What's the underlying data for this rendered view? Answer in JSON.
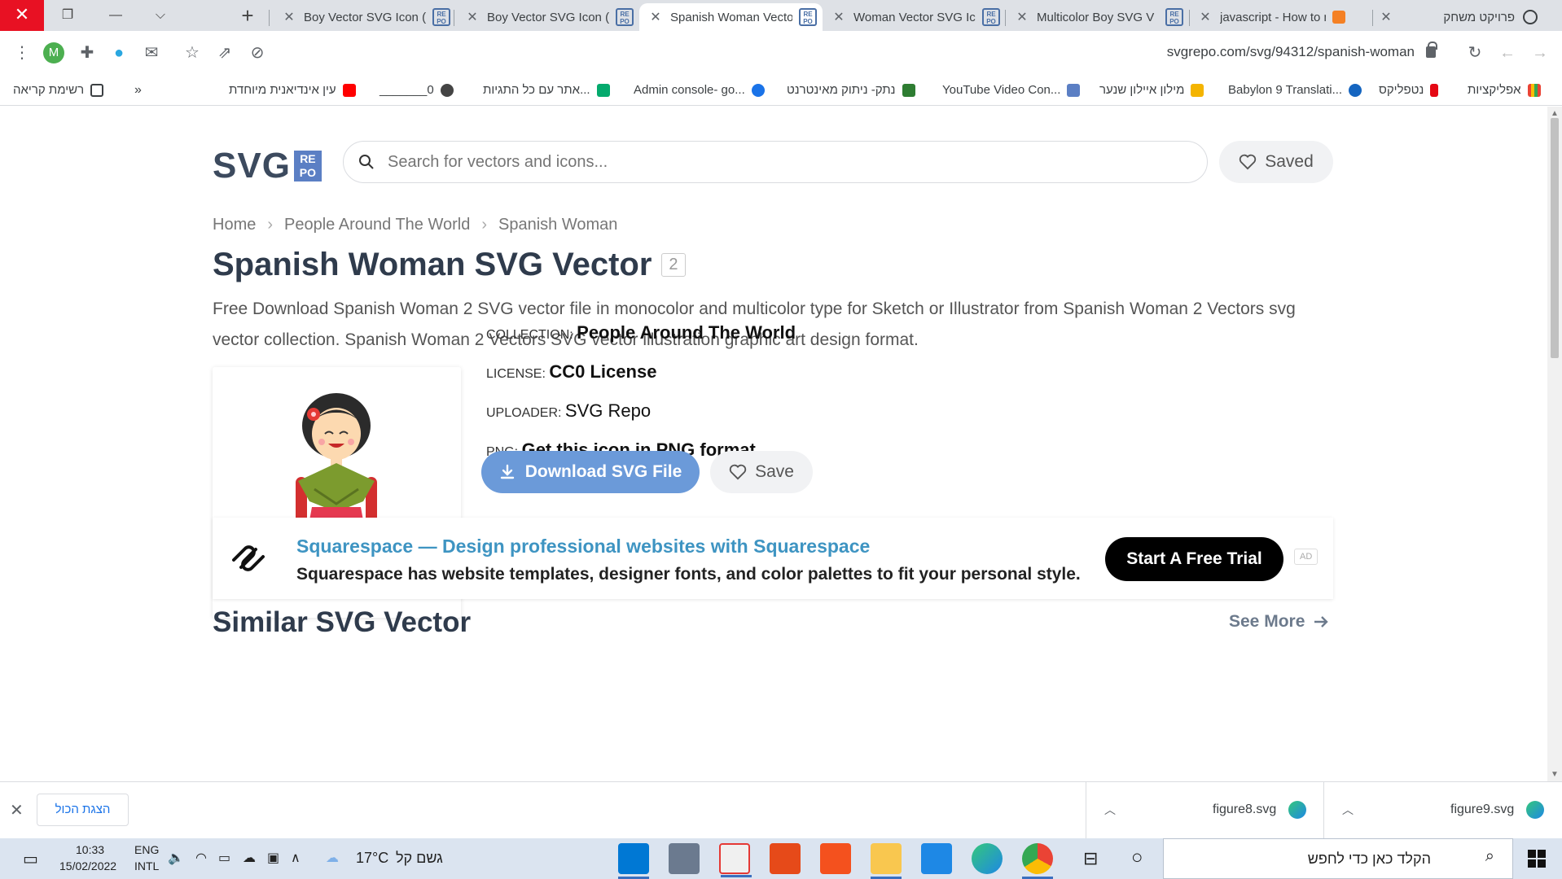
{
  "browser": {
    "tabs": [
      {
        "title": "Boy Vector SVG Icon (",
        "active": false
      },
      {
        "title": "Boy Vector SVG Icon (",
        "active": false
      },
      {
        "title": "Spanish Woman Vecto",
        "active": true
      },
      {
        "title": "Woman Vector SVG Ic",
        "active": false
      },
      {
        "title": "Multicolor Boy SVG V",
        "active": false
      },
      {
        "title": "javascript - How to m",
        "active": false
      }
    ],
    "project_tab": "פרויקט משחק",
    "url": "svgrepo.com/svg/94312/spanish-woman",
    "profile_initial": "M",
    "bookmarks": [
      {
        "label": "רשימת קריאה",
        "icon": "reading-list-icon"
      },
      {
        "label": "עין אינדיאנית מיוחדת",
        "icon": "youtube-icon"
      },
      {
        "label": "_______0",
        "icon": "globe-icon"
      },
      {
        "label": "אתר עם כל התגיות...",
        "icon": "w3-icon"
      },
      {
        "label": "Admin console- go...",
        "icon": "admin-icon"
      },
      {
        "label": "נתק- ניתוק מאינטרנט",
        "icon": "y-icon"
      },
      {
        "label": "YouTube Video Con...",
        "icon": "converter-icon"
      },
      {
        "label": "מילון איילון שנער",
        "icon": "dictionary-icon"
      },
      {
        "label": "Babylon 9 Translati...",
        "icon": "babylon-icon"
      },
      {
        "label": "נטפליקס",
        "icon": "netflix-icon"
      },
      {
        "label": "אפליקציות",
        "icon": "apps-icon"
      }
    ],
    "more_bookmarks": "»"
  },
  "site": {
    "logo_text": "SVG",
    "logo_badge_top": "RE",
    "logo_badge_bottom": "PO",
    "search_placeholder": "Search for vectors and icons...",
    "saved_label": "Saved",
    "accent": "#6b9ad9"
  },
  "breadcrumb": [
    "Home",
    "People Around The World",
    "Spanish Woman"
  ],
  "title": "Spanish Woman SVG Vector",
  "title_count": "2",
  "description": "Free Download Spanish Woman 2 SVG vector file in monocolor and multicolor type for Sketch or Illustrator from Spanish Woman 2 Vectors svg vector collection. Spanish Woman 2 Vectors SVG vector illustration graphic art design format.",
  "meta": {
    "collection_label": "COLLECTION:",
    "collection_value": "People Around The World",
    "license_label": "LICENSE:",
    "license_value": "CC0 License",
    "uploader_label": "UPLOADER:",
    "uploader_value": "SVG Repo",
    "png_label": "PNG:",
    "png_value": "Get this icon in PNG format"
  },
  "actions": {
    "download_label": "Download SVG File",
    "save_label": "Save"
  },
  "ad": {
    "title": "Squarespace — Design professional websites with Squarespace",
    "body": "Squarespace has website templates, designer fonts, and color palettes to fit your personal style.",
    "cta": "Start A Free Trial",
    "tag": "AD"
  },
  "similar": {
    "heading": "Similar SVG Vector",
    "see_more": "See More"
  },
  "downloads": {
    "show_all": "הצגת הכול",
    "files": [
      "figure8.svg",
      "figure9.svg"
    ]
  },
  "taskbar": {
    "time": "10:33",
    "date": "15/02/2022",
    "lang_top": "ENG",
    "lang_bottom": "INTL",
    "weather": "17°C",
    "weather_text": "גשם קל",
    "search_placeholder": "הקלד כאן כדי לחפש"
  }
}
